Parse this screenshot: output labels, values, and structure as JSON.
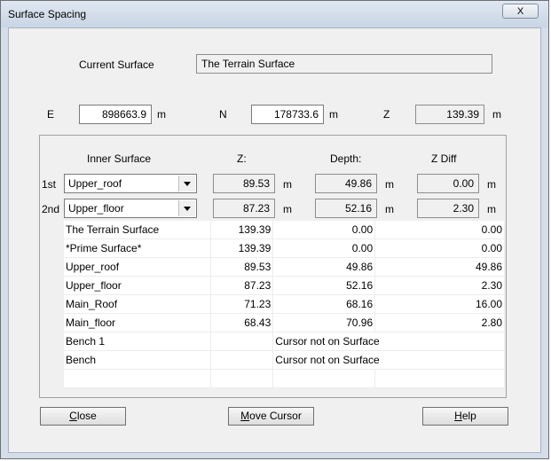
{
  "window": {
    "title": "Surface Spacing",
    "close_glyph": "X"
  },
  "current_surface": {
    "label": "Current Surface",
    "value": "The Terrain Surface"
  },
  "coords": {
    "e_label": "E",
    "e_value": "898663.9",
    "e_unit": "m",
    "n_label": "N",
    "n_value": "178733.6",
    "n_unit": "m",
    "z_label": "Z",
    "z_value": "139.39",
    "z_unit": "m"
  },
  "headers": {
    "inner_surface": "Inner Surface",
    "z": "Z:",
    "depth": "Depth:",
    "zdiff": "Z Diff"
  },
  "rows": [
    {
      "label": "1st",
      "surface": "Upper_roof",
      "z": "89.53",
      "z_unit": "m",
      "depth": "49.86",
      "depth_unit": "m",
      "zdiff": "0.00",
      "zdiff_unit": "m"
    },
    {
      "label": "2nd",
      "surface": "Upper_floor",
      "z": "87.23",
      "z_unit": "m",
      "depth": "52.16",
      "depth_unit": "m",
      "zdiff": "2.30",
      "zdiff_unit": "m"
    }
  ],
  "table": [
    {
      "name": "The Terrain Surface",
      "z": "139.39",
      "depth": "0.00",
      "zdiff": "0.00"
    },
    {
      "name": "*Prime Surface*",
      "z": "139.39",
      "depth": "0.00",
      "zdiff": "0.00"
    },
    {
      "name": "Upper_roof",
      "z": "89.53",
      "depth": "49.86",
      "zdiff": "49.86"
    },
    {
      "name": "Upper_floor",
      "z": "87.23",
      "depth": "52.16",
      "zdiff": "2.30"
    },
    {
      "name": "Main_Roof",
      "z": "71.23",
      "depth": "68.16",
      "zdiff": "16.00"
    },
    {
      "name": "Main_floor",
      "z": "68.43",
      "depth": "70.96",
      "zdiff": "2.80"
    },
    {
      "name": "Bench 1",
      "note": "Cursor not on Surface"
    },
    {
      "name": "Bench",
      "note": "Cursor not on Surface"
    },
    {
      "name": ""
    }
  ],
  "buttons": {
    "close_first": "C",
    "close_rest": "lose",
    "move_first": "M",
    "move_rest": "ove Cursor",
    "help_first": "H",
    "help_rest": "elp"
  }
}
